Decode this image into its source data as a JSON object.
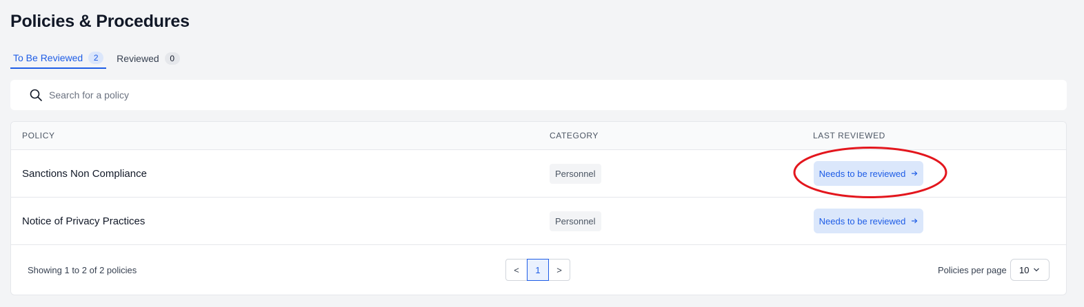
{
  "page": {
    "title": "Policies & Procedures"
  },
  "tabs": [
    {
      "label": "To Be Reviewed",
      "count": "2",
      "active": true
    },
    {
      "label": "Reviewed",
      "count": "0",
      "active": false
    }
  ],
  "search": {
    "placeholder": "Search for a policy",
    "value": ""
  },
  "table": {
    "columns": [
      "POLICY",
      "CATEGORY",
      "LAST REVIEWED"
    ],
    "rows": [
      {
        "policy": "Sanctions Non Compliance",
        "category": "Personnel",
        "status": "Needs to be reviewed"
      },
      {
        "policy": "Notice of Privacy Practices",
        "category": "Personnel",
        "status": "Needs to be reviewed"
      }
    ]
  },
  "footer": {
    "summary": "Showing 1 to 2 of 2 policies",
    "pagination": {
      "prev": "<",
      "current": "1",
      "next": ">"
    },
    "per_page_label": "Policies per page",
    "per_page_value": "10"
  },
  "colors": {
    "accent": "#1d5ce6",
    "status_bg": "#dbe7fb",
    "highlight": "#e3161d"
  },
  "icons": {
    "search": "search-icon",
    "arrow": "arrow-right-icon",
    "chevron": "chevron-down-icon"
  }
}
